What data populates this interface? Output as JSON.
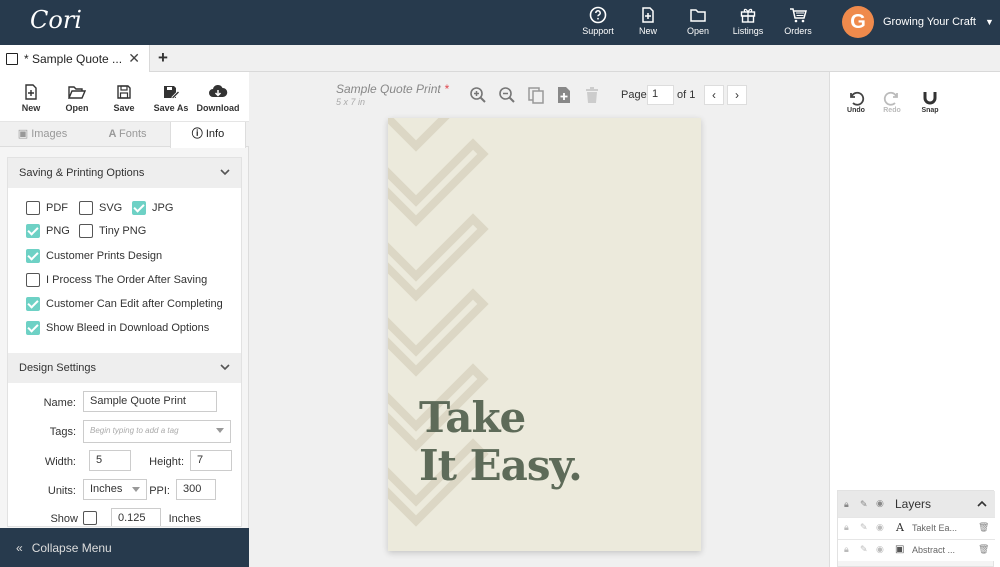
{
  "topbar": {
    "logo": "Cori",
    "nav": [
      {
        "label": "Support",
        "icon": "help-circle-icon"
      },
      {
        "label": "New",
        "icon": "new-file-icon"
      },
      {
        "label": "Open",
        "icon": "folder-icon"
      },
      {
        "label": "Listings",
        "icon": "gift-icon"
      },
      {
        "label": "Orders",
        "icon": "cart-icon"
      }
    ],
    "account": {
      "avatar_letter": "G",
      "name": "Growing Your Craft"
    },
    "colors": {
      "bar": "#273a4d",
      "avatar": "#ef8a4c"
    }
  },
  "doc_tab": {
    "title": "* Sample Quote ...",
    "close": "✕",
    "add": "+"
  },
  "left_toolbar": [
    {
      "label": "New",
      "icon": "new-file-icon"
    },
    {
      "label": "Open",
      "icon": "folder-open-icon"
    },
    {
      "label": "Save",
      "icon": "save-icon"
    },
    {
      "label": "Save As",
      "icon": "save-as-icon"
    },
    {
      "label": "Download",
      "icon": "download-icon"
    }
  ],
  "subtabs": {
    "images": "Images",
    "fonts": "Fonts",
    "info": "Info",
    "active": "Info"
  },
  "saving_section": {
    "title": "Saving & Printing Options",
    "options": [
      {
        "label": "PDF",
        "checked": false
      },
      {
        "label": "SVG",
        "checked": false
      },
      {
        "label": "JPG",
        "checked": true
      },
      {
        "label": "PNG",
        "checked": true
      },
      {
        "label": "Tiny PNG",
        "checked": false
      },
      {
        "label": "Customer Prints Design",
        "checked": true
      },
      {
        "label": "I Process The Order After Saving",
        "checked": false
      },
      {
        "label": "Customer Can Edit after Completing",
        "checked": true
      },
      {
        "label": "Show Bleed in Download Options",
        "checked": true
      }
    ],
    "check_color": "#6ed1c5"
  },
  "design_section": {
    "title": "Design Settings",
    "name_label": "Name:",
    "name_value": "Sample Quote Print",
    "tags_label": "Tags:",
    "tags_placeholder": "Begin typing to add a tag",
    "width_label": "Width:",
    "width_value": "5",
    "height_label": "Height:",
    "height_value": "7",
    "units_label": "Units:",
    "units_value": "Inches",
    "ppi_label": "PPI:",
    "ppi_value": "300",
    "bleed_label": "Show Bleed:",
    "bleed_checked": false,
    "bleed_value": "0.125",
    "bleed_unit": "Inches"
  },
  "collapse_menu": {
    "arrow": "«",
    "label": "Collapse Menu"
  },
  "canvas": {
    "doc_title": "Sample Quote Print",
    "unsaved_marker": "*",
    "doc_size": "5 x 7 in",
    "page_label": "Page",
    "page_value": "1",
    "page_of": "of 1",
    "prev": "‹",
    "next": "›",
    "quote_line1": "Take",
    "quote_line2": "It Easy.",
    "artboard_color": "#eceadc",
    "quote_color": "#5e6b59"
  },
  "right_tools": [
    {
      "label": "Undo",
      "icon": "undo-icon",
      "enabled": true
    },
    {
      "label": "Redo",
      "icon": "redo-icon",
      "enabled": false
    },
    {
      "label": "Snap",
      "icon": "magnet-icon",
      "enabled": true
    }
  ],
  "layers": {
    "title": "Layers",
    "items": [
      {
        "name": "TakeIt Ea...",
        "type_icon": "text-icon"
      },
      {
        "name": "Abstract ...",
        "type_icon": "image-icon"
      }
    ]
  }
}
